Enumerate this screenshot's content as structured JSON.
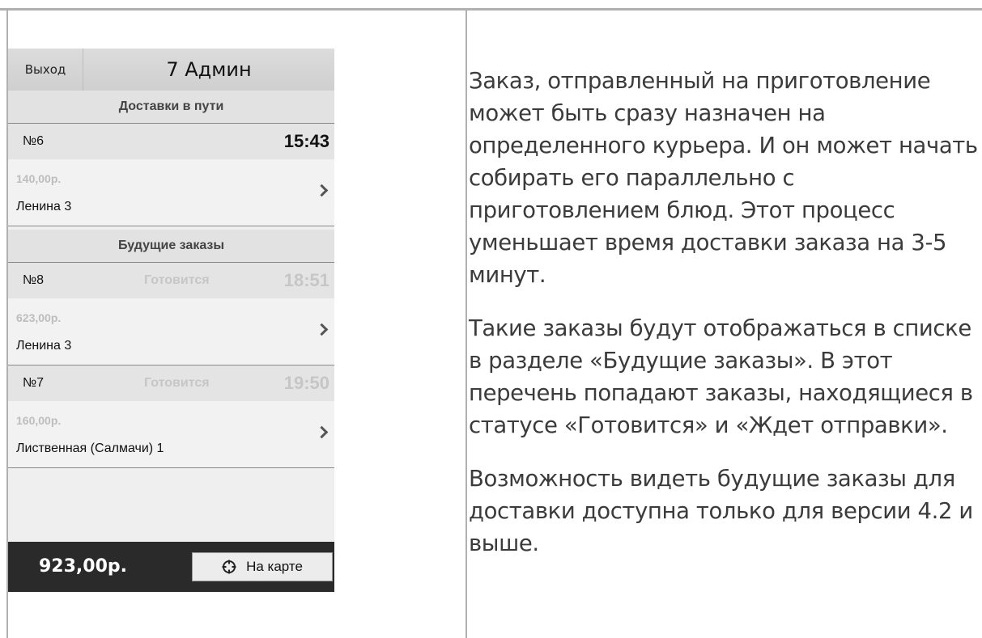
{
  "app": {
    "exit_label": "Выход",
    "title": "7 Админ"
  },
  "sections": [
    {
      "heading": "Доставки в пути",
      "orders": [
        {
          "number": "№6",
          "status": "",
          "time": "15:43",
          "price": "140,00р.",
          "address": "Ленина 3"
        }
      ]
    },
    {
      "heading": "Будущие заказы",
      "orders": [
        {
          "number": "№8",
          "status": "Готовится",
          "time": "18:51",
          "price": "623,00р.",
          "address": "Ленина 3"
        },
        {
          "number": "№7",
          "status": "Готовится",
          "time": "19:50",
          "price": "160,00р.",
          "address": "Лиственная (Салмачи) 1"
        }
      ]
    }
  ],
  "footer": {
    "total": "923,00р.",
    "map_button_label": "На карте",
    "map_button_icon": "crosshair-icon"
  },
  "description": {
    "paragraphs": [
      "Заказ, отправленный на приготовление может быть сразу назначен на определенного курьера. И он может начать собирать его параллельно с приготовлением блюд. Этот процесс уменьшает время доставки заказа на 3-5 минут.",
      "Такие заказы будут отображаться в списке в разделе «Будущие заказы». В этот перечень попадают заказы, находящиеся в статусе «Готовится» и «Ждет отправки».",
      "Возможность видеть будущие заказы для доставки доступна только для версии 4.2 и выше."
    ]
  },
  "colors": {
    "header_bg": "#d6d6d6",
    "footer_bg": "#2a2a2a",
    "muted_text": "#c6c6c6"
  }
}
